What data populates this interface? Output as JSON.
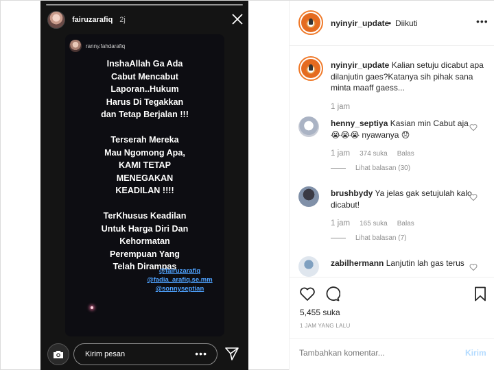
{
  "story": {
    "user": "fairuzarafiq",
    "time": "2j",
    "icons": {
      "close": "close-icon",
      "camera": "camera-icon",
      "send": "send-icon"
    },
    "card": {
      "user": "ranny.fahdarafiq",
      "text": "InshaAllah Ga Ada\nCabut Mencabut\nLaporan..Hukum\nHarus Di Tegakkan\ndan Tetap Berjalan !!!\n\nTerserah Mereka\nMau Ngomong Apa,\nKAMI TETAP\nMENEGAKAN\nKEADILAN !!!!\n\nTerKhusus Keadilan\nUntuk Harga Diri Dan\nKehormatan\nPerempuan Yang\nTelah Dirampas",
      "mentions": [
        "@fairuzarafiq",
        "@fadia_arafiq.se.mm",
        "@sonnyseptian"
      ],
      "mention_color": "#4ea2ff"
    },
    "message_placeholder": "Kirim pesan",
    "message_more": "•••"
  },
  "post": {
    "header": {
      "user": "nyinyir_update",
      "dot": "•",
      "follow": "Diikuti",
      "more": "•••"
    },
    "caption": {
      "user": "nyinyir_update",
      "text": "Kalian setuju dicabut apa dilanjutin gaes?Katanya sih pihak sana minta maaff gaess...",
      "time": "1 jam"
    },
    "comments": [
      {
        "user": "henny_septiya",
        "text": "Kasian min Cabut aja 😭😭😭 nyawanya 😞",
        "time": "1 jam",
        "likes": "374 suka",
        "reply": "Balas",
        "replies": "Lihat balasan (30)",
        "avatar_color": "#c8ccd6"
      },
      {
        "user": "brushbydy",
        "text": "Ya jelas gak setujulah kalo dicabut!",
        "time": "1 jam",
        "likes": "165 suka",
        "reply": "Balas",
        "replies": "Lihat balasan (7)",
        "avatar_color": "#5a6a86"
      },
      {
        "user": "zabilhermann",
        "text": "Lanjutin lah gas terus",
        "avatar_color": "#dfe6ee"
      }
    ],
    "likes_count": "5,455 suka",
    "posted": "1 JAM YANG LALU",
    "comment_placeholder": "Tambahkan komentar...",
    "comment_send": "Kirim",
    "brand_colors": {
      "avatar_ring": "#f07a2a",
      "send_disabled": "#b3dbff",
      "muted": "#8e8e8e"
    }
  }
}
